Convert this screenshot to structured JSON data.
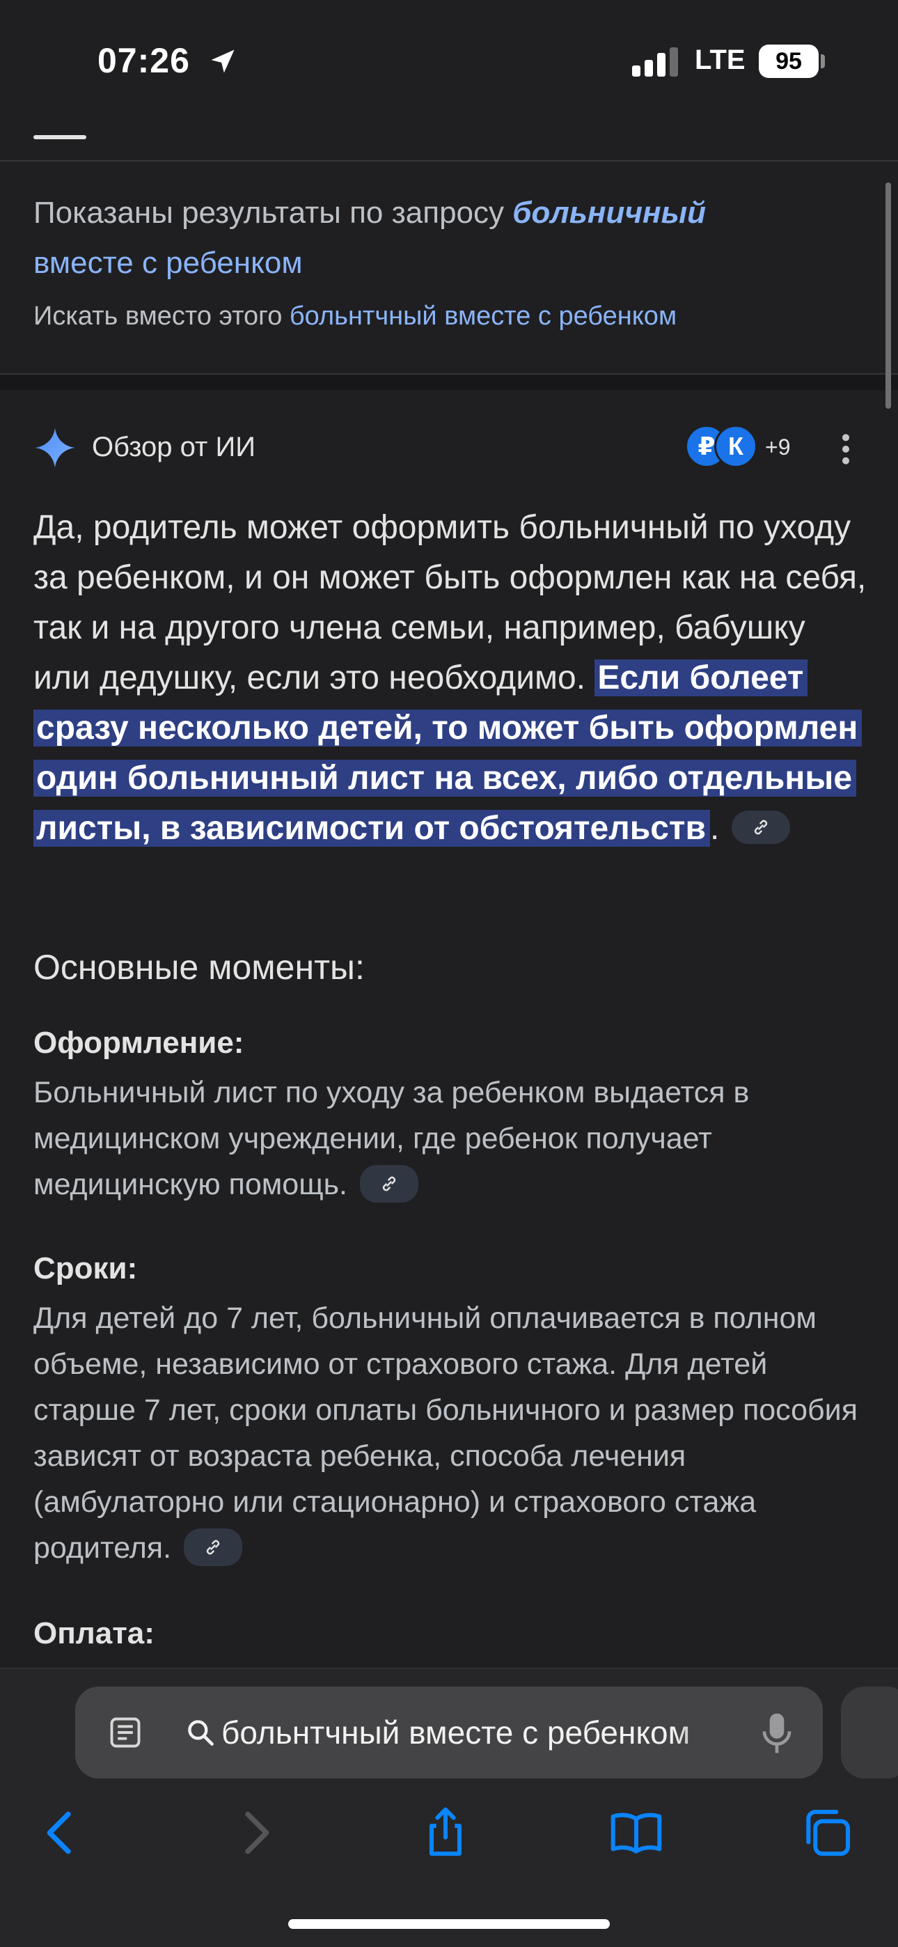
{
  "status_bar": {
    "time": "07:26",
    "network": "LTE",
    "battery": "95"
  },
  "query_correction": {
    "showing_prefix": "Показаны результаты по запросу ",
    "corrected_query_bold": "больничный",
    "corrected_query_rest": "вместе с ребенком",
    "instead_prefix": "Искать вместо этого ",
    "original_query": "больнтчный вместе с ребенком"
  },
  "ai_overview": {
    "title": "Обзор от ИИ",
    "source_badges": [
      "₽",
      "К"
    ],
    "more_sources": "+9",
    "summary_plain": "Да, родитель может оформить больничный по уходу за ребенком, и он может быть оформлен как на себя, так и на другого члена семьи, например, бабушку или дедушку, если это необходимо. ",
    "summary_highlight": "Если болеет сразу несколько детей, то может быть оформлен один больничный лист на всех, либо отдельные листы, в зависимости от обстоятельств",
    "summary_end": ".",
    "key_points_heading": "Основные моменты:",
    "key_points": [
      {
        "title": "Оформление:",
        "body": "Больничный лист по уходу за ребенком выдается в медицинском учреждении, где ребенок получает медицинскую помощь."
      },
      {
        "title": "Сроки:",
        "body": "Для детей до 7 лет, больничный оплачивается в полном объеме, независимо от страхового стажа. Для детей старше 7 лет, сроки оплаты больничного и размер пособия зависят от возраста ребенка, способа лечения (амбулаторно или стационарно) и страхового стажа родителя."
      },
      {
        "title": "Оплата:"
      }
    ]
  },
  "browser": {
    "address_text": "больнтчный вместе с ребенком",
    "icons": [
      "reader-icon",
      "search-icon",
      "microphone-icon",
      "back-icon",
      "forward-icon",
      "share-icon",
      "bookmarks-icon",
      "tabs-icon"
    ]
  },
  "colors": {
    "background": "#1f1f21",
    "link": "#8ab4f8",
    "highlight": "#2e3f84",
    "ios_blue": "#0a84ff"
  }
}
